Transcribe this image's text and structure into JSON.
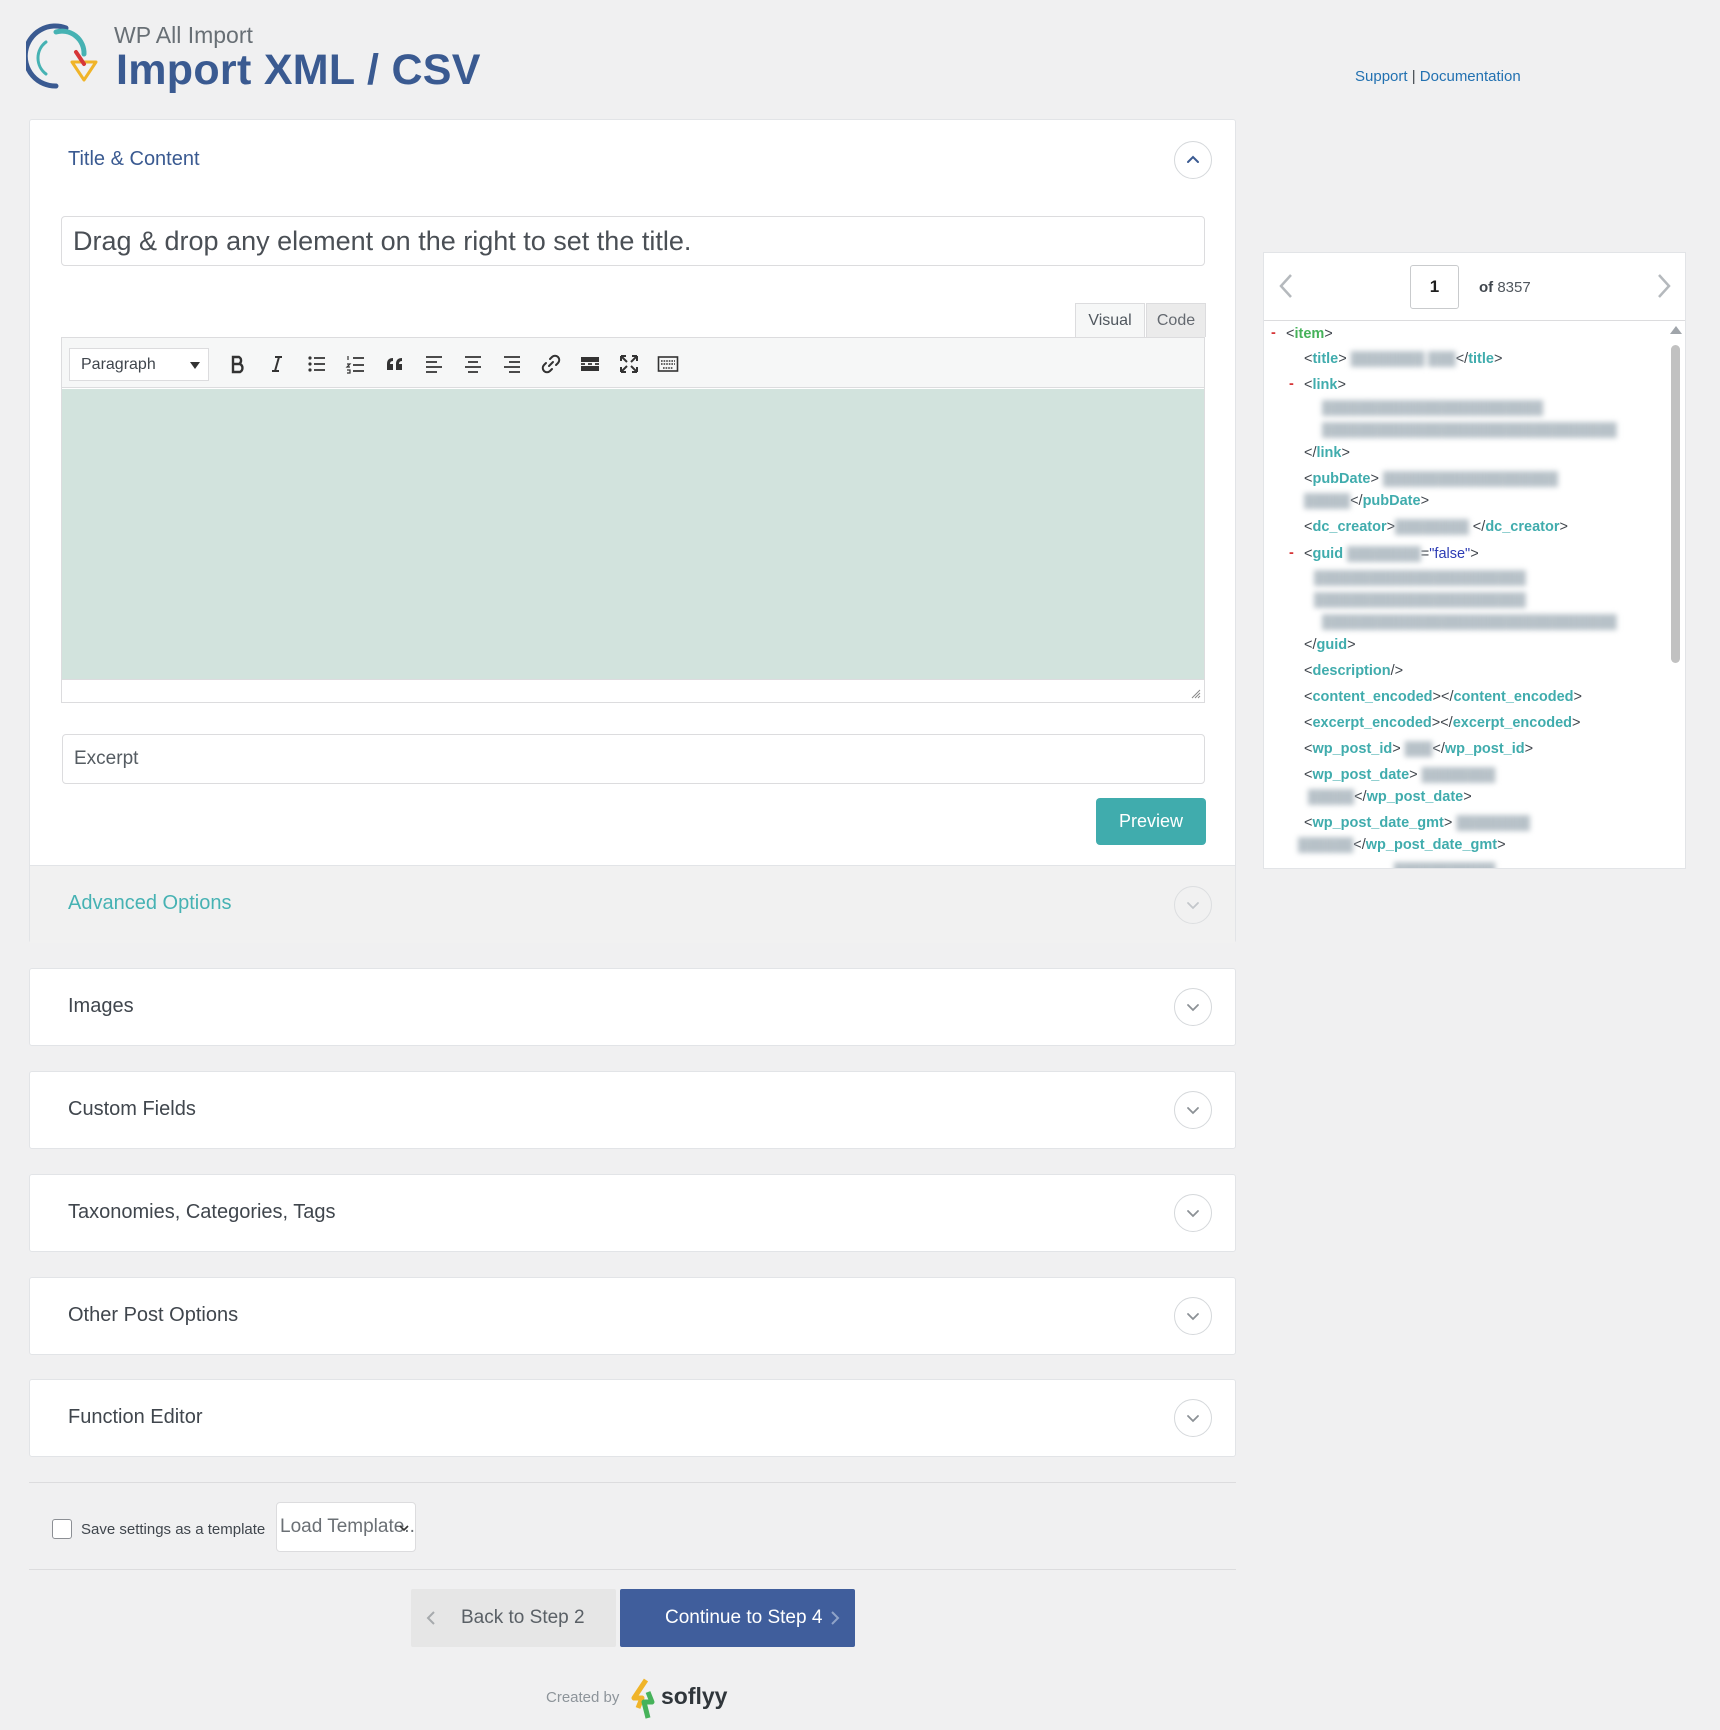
{
  "header": {
    "app_name": "WP All Import",
    "page_title": "Import XML / CSV",
    "support_link": "Support",
    "separator": "|",
    "docs_link": "Documentation"
  },
  "title_content": {
    "heading": "Title & Content",
    "title_placeholder": "Drag & drop any element on the right to set the title.",
    "tabs": {
      "visual": "Visual",
      "code": "Code"
    },
    "format_select": "Paragraph",
    "excerpt_placeholder": "Excerpt",
    "preview_button": "Preview"
  },
  "advanced_options": {
    "heading": "Advanced Options"
  },
  "sections": [
    {
      "label": "Images"
    },
    {
      "label": "Custom Fields"
    },
    {
      "label": "Taxonomies, Categories, Tags"
    },
    {
      "label": "Other Post Options"
    },
    {
      "label": "Function Editor"
    }
  ],
  "footer": {
    "save_template_label": "Save settings as a template",
    "load_template": "Load Template...",
    "back_button": "Back to Step 2",
    "continue_button": "Continue to Step 4",
    "created_by": "Created by",
    "brand": "soflyy"
  },
  "xml_viewer": {
    "current_record": "1",
    "of_label": "of",
    "total_records": "8357",
    "tags": {
      "item": "item",
      "title": "title",
      "link": "link",
      "pubDate": "pubDate",
      "dc_creator": "dc_creator",
      "guid": "guid",
      "guid_attr_value": "\"false\"",
      "description": "description",
      "content_encoded": "content_encoded",
      "excerpt_encoded": "excerpt_encoded",
      "wp_post_id": "wp_post_id",
      "wp_post_date": "wp_post_date",
      "wp_post_date_gmt": "wp_post_date_gmt"
    }
  },
  "colors": {
    "brand_blue": "#3a5a91",
    "teal": "#40acad",
    "editor_bg": "#d2e3dd",
    "continue_bg": "#405e9c"
  }
}
